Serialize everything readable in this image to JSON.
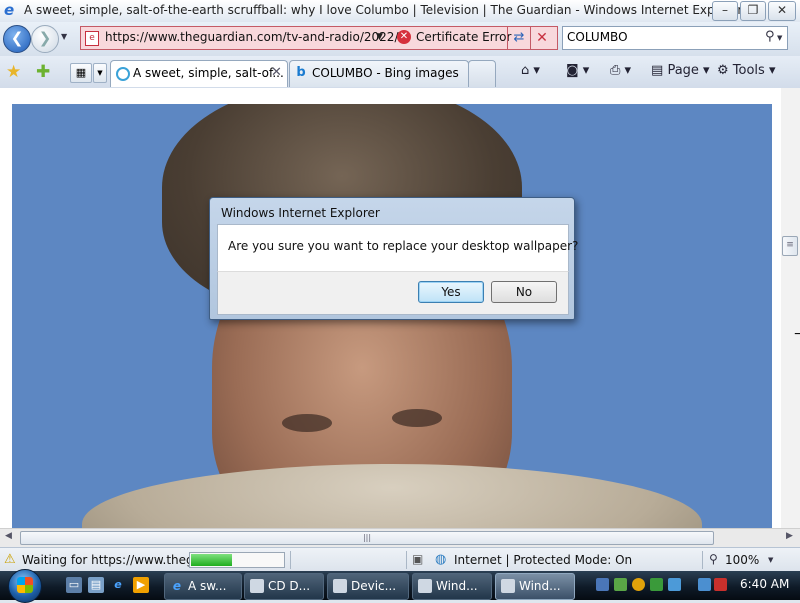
{
  "window": {
    "title": "A sweet, simple, salt-of-the-earth scruffball: why I love Columbo | Television | The Guardian - Windows Internet Explorer",
    "caption_buttons": [
      "–",
      "❐",
      "✕"
    ]
  },
  "address_bar": {
    "url": "https://www.theguardian.com/tv-and-radio/2022/",
    "certificate_label": "Certificate Error",
    "back_icon": "back-arrow-icon",
    "forward_icon": "forward-arrow-icon"
  },
  "search": {
    "value": "COLUMBO"
  },
  "tabs": [
    {
      "label": "A sweet, simple, salt-of...",
      "active": true
    },
    {
      "label": "COLUMBO - Bing images",
      "active": false
    }
  ],
  "command_bar": {
    "page_label": "Page",
    "tools_label": "Tools"
  },
  "dialog": {
    "title": "Windows Internet Explorer",
    "message": "Are you sure you want to replace your desktop wallpaper?",
    "yes_label": "Yes",
    "no_label": "No"
  },
  "status_bar": {
    "text": "Waiting for https://www.thegu",
    "progress": 0.45,
    "zone": "Internet | Protected Mode: On",
    "zoom": "100%"
  },
  "taskbar": {
    "items": [
      {
        "label": "A sw..."
      },
      {
        "label": "CD D..."
      },
      {
        "label": "Devic..."
      },
      {
        "label": "Wind..."
      },
      {
        "label": "Wind..."
      }
    ],
    "clock": "6:40 AM"
  },
  "colors": {
    "address_error_bg": "#f8d8dc",
    "accent": "#1d5bb8"
  }
}
